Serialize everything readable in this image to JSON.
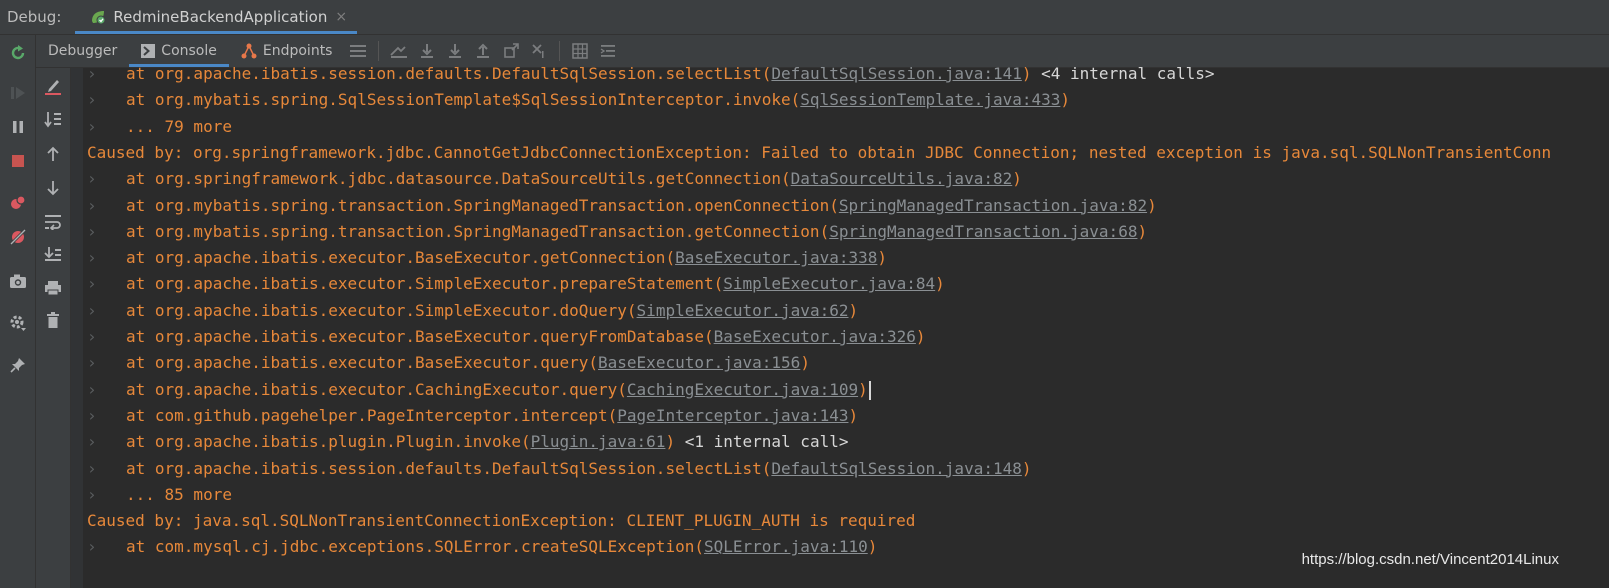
{
  "window": {
    "debug_label": "Debug:",
    "run_tab_label": "RedmineBackendApplication",
    "run_tab_close": "×"
  },
  "subtabs": [
    {
      "label": "Debugger",
      "icon": "none",
      "active": false
    },
    {
      "label": "Console",
      "icon": "console-icon",
      "active": true
    },
    {
      "label": "Endpoints",
      "icon": "endpoints-icon",
      "active": false
    }
  ],
  "icons": {
    "left_toolbar": [
      "rerun-icon",
      "resume-icon",
      "pause-icon",
      "stop-icon",
      "view-breakpoints-icon",
      "mute-breakpoints-icon",
      "camera-icon",
      "settings-icon",
      "pin-icon"
    ],
    "subbar_tools": [
      "menu-icon",
      "show-execution-point-icon",
      "step-over-icon",
      "step-into-icon",
      "step-out-icon",
      "drop-frame-icon",
      "run-to-cursor-icon",
      "evaluate-icon",
      "trace-icon"
    ],
    "console_toolbar": [
      "clear-edit-icon",
      "sort-icon",
      "up-arrow-icon",
      "down-arrow-icon",
      "soft-wrap-icon",
      "scroll-to-end-icon",
      "print-icon",
      "trash-icon"
    ]
  },
  "colors": {
    "background": "#2b2b2b",
    "toolbar": "#3c3f41",
    "error_text": "#e7883a",
    "link": "#8a8f93",
    "accent": "#4a88c7"
  },
  "console": {
    "lines": [
      {
        "fold": "›",
        "text": "at org.apache.ibatis.session.defaults.DefaultSqlSession.selectList(",
        "link": "DefaultSqlSession.java:141",
        "after": ")",
        "extra": " <4 internal calls>"
      },
      {
        "fold": "›",
        "text": "at org.mybatis.spring.SqlSessionTemplate$SqlSessionInterceptor.invoke(",
        "link": "SqlSessionTemplate.java:433",
        "after": ")",
        "extra": ""
      },
      {
        "fold": "›",
        "text": "... 79 more",
        "link": "",
        "after": "",
        "extra": ""
      },
      {
        "fold": "",
        "text": "Caused by: org.springframework.jdbc.CannotGetJdbcConnectionException: Failed to obtain JDBC Connection; nested exception is java.sql.SQLNonTransientConn",
        "link": "",
        "after": "",
        "extra": ""
      },
      {
        "fold": "›",
        "text": "at org.springframework.jdbc.datasource.DataSourceUtils.getConnection(",
        "link": "DataSourceUtils.java:82",
        "after": ")",
        "extra": ""
      },
      {
        "fold": "›",
        "text": "at org.mybatis.spring.transaction.SpringManagedTransaction.openConnection(",
        "link": "SpringManagedTransaction.java:82",
        "after": ")",
        "extra": ""
      },
      {
        "fold": "›",
        "text": "at org.mybatis.spring.transaction.SpringManagedTransaction.getConnection(",
        "link": "SpringManagedTransaction.java:68",
        "after": ")",
        "extra": ""
      },
      {
        "fold": "›",
        "text": "at org.apache.ibatis.executor.BaseExecutor.getConnection(",
        "link": "BaseExecutor.java:338",
        "after": ")",
        "extra": ""
      },
      {
        "fold": "›",
        "text": "at org.apache.ibatis.executor.SimpleExecutor.prepareStatement(",
        "link": "SimpleExecutor.java:84",
        "after": ")",
        "extra": ""
      },
      {
        "fold": "›",
        "text": "at org.apache.ibatis.executor.SimpleExecutor.doQuery(",
        "link": "SimpleExecutor.java:62",
        "after": ")",
        "extra": ""
      },
      {
        "fold": "›",
        "text": "at org.apache.ibatis.executor.BaseExecutor.queryFromDatabase(",
        "link": "BaseExecutor.java:326",
        "after": ")",
        "extra": ""
      },
      {
        "fold": "›",
        "text": "at org.apache.ibatis.executor.BaseExecutor.query(",
        "link": "BaseExecutor.java:156",
        "after": ")",
        "extra": ""
      },
      {
        "fold": "›",
        "text": "at org.apache.ibatis.executor.CachingExecutor.query(",
        "link": "CachingExecutor.java:109",
        "after": ")",
        "extra": "",
        "caret": true
      },
      {
        "fold": "›",
        "text": "at com.github.pagehelper.PageInterceptor.intercept(",
        "link": "PageInterceptor.java:143",
        "after": ")",
        "extra": ""
      },
      {
        "fold": "›",
        "text": "at org.apache.ibatis.plugin.Plugin.invoke(",
        "link": "Plugin.java:61",
        "after": ")",
        "extra": " <1 internal call>"
      },
      {
        "fold": "›",
        "text": "at org.apache.ibatis.session.defaults.DefaultSqlSession.selectList(",
        "link": "DefaultSqlSession.java:148",
        "after": ")",
        "extra": ""
      },
      {
        "fold": "›",
        "text": "... 85 more",
        "link": "",
        "after": "",
        "extra": ""
      },
      {
        "fold": "",
        "text": "Caused by: java.sql.SQLNonTransientConnectionException: CLIENT_PLUGIN_AUTH is required",
        "link": "",
        "after": "",
        "extra": ""
      },
      {
        "fold": "›",
        "text": "at com.mysql.cj.jdbc.exceptions.SQLError.createSQLException(",
        "link": "SQLError.java:110",
        "after": ")",
        "extra": ""
      }
    ]
  },
  "watermark": "https://blog.csdn.net/Vincent2014Linux"
}
